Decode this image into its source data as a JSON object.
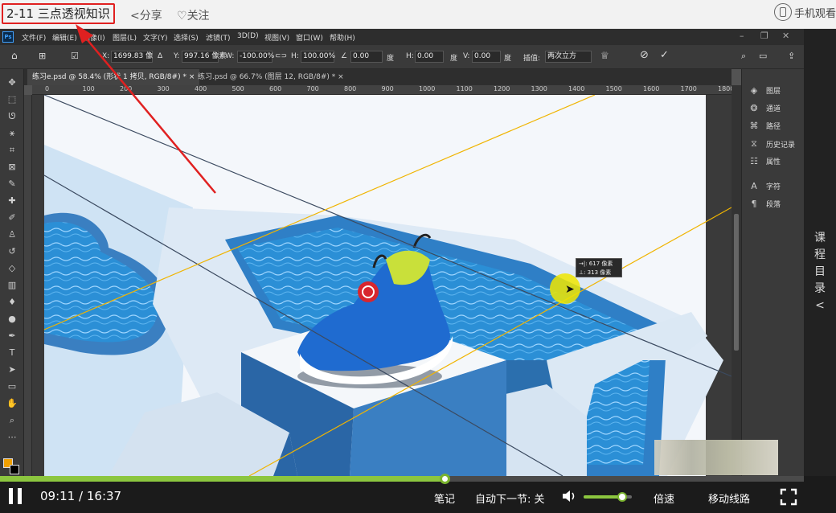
{
  "topbar": {
    "lesson_title": "2-11 三点透视知识",
    "share_label": "分享",
    "follow_label": "关注",
    "mobile_label": "手机观看"
  },
  "side_panel": {
    "label_chars": [
      "课",
      "程",
      "目",
      "录",
      "<"
    ]
  },
  "photoshop": {
    "logo": "Ps",
    "menu": [
      "文件(F)",
      "编辑(E)",
      "图像(I)",
      "图层(L)",
      "文字(Y)",
      "选择(S)",
      "滤镜(T)",
      "3D(D)",
      "视图(V)",
      "窗口(W)",
      "帮助(H)"
    ],
    "options": {
      "x_label": "X:",
      "x_value": "1699.83 像",
      "y_label": "Y:",
      "y_value": "997.16 像素",
      "w_label": "W:",
      "w_value": "-100.00%",
      "h_label": "H:",
      "h_value": "100.00%",
      "angle_value": "0.00",
      "angle_unit": "度",
      "hskew_label": "H:",
      "hskew_value": "0.00",
      "hskew_unit": "度",
      "vskew_label": "V:",
      "vskew_value": "0.00",
      "vskew_unit": "度",
      "interp_label": "插值:",
      "interp_value": "两次立方"
    },
    "tabs": [
      {
        "label": "练习e.psd @ 58.4% (形状 1 拷贝, RGB/8#) *",
        "close": "×"
      },
      {
        "label": "练习.psd @ 66.7% (图层 12, RGB/8#) *",
        "close": "×"
      }
    ],
    "ruler_ticks": [
      "0",
      "100",
      "200",
      "300",
      "400",
      "500",
      "600",
      "700",
      "800",
      "900",
      "1000",
      "1100",
      "1200",
      "1300",
      "1400",
      "1500",
      "1600",
      "1700",
      "1800"
    ],
    "panels": [
      {
        "icon": "layers-icon",
        "label": "图层"
      },
      {
        "icon": "channels-icon",
        "label": "通道"
      },
      {
        "icon": "paths-icon",
        "label": "路径"
      },
      {
        "icon": "history-icon",
        "label": "历史记录"
      },
      {
        "icon": "properties-icon",
        "label": "属性"
      },
      {
        "icon": "character-icon",
        "label": "字符"
      },
      {
        "icon": "paragraph-icon",
        "label": "段落"
      }
    ],
    "measure": {
      "line1": "→|: 617 像素",
      "line2": "⊥: 313 像素"
    }
  },
  "player": {
    "progress": 0.5525,
    "current_time": "09:11",
    "separator": "/",
    "total_time": "16:37",
    "notes_label": "笔记",
    "autonext_label": "自动下一节: 关",
    "volume": 0.8,
    "speed_label": "倍速",
    "route_label": "移动线路"
  },
  "colors": {
    "accent_green": "#8cc63f",
    "annotation_red": "#e02020",
    "pool_blue": "#2f7fc6",
    "foreground_swatch": "#f0a000"
  }
}
